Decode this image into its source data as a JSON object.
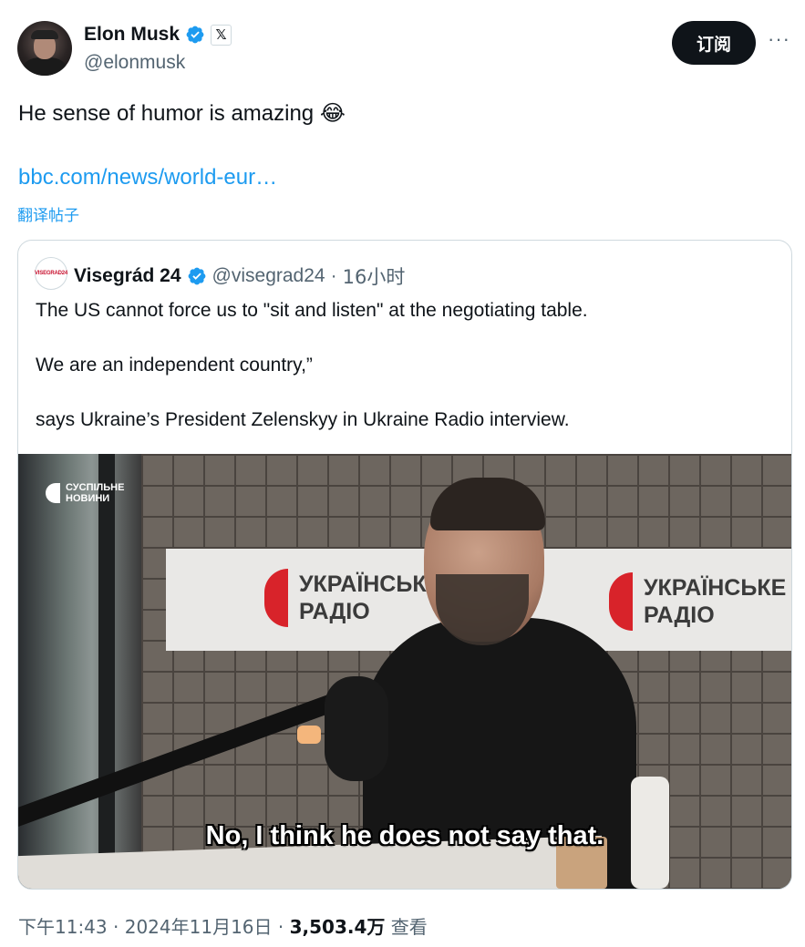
{
  "author": {
    "name": "Elon Musk",
    "handle": "@elonmusk",
    "x_badge": "𝕏"
  },
  "actions": {
    "subscribe_label": "订阅",
    "more_label": "···"
  },
  "tweet": {
    "text": "He sense of humor is amazing 😂",
    "link": "bbc.com/news/world-eur…",
    "translate_label": "翻译帖子"
  },
  "quote": {
    "avatar_text": "VISEGRAD24",
    "name": "Visegrád 24",
    "handle": "@visegrad24",
    "separator": "·",
    "time": "16小时",
    "paragraphs": [
      "The US cannot force us to \"sit and listen\" at the negotiating table.",
      "We are an independent country,”",
      "says Ukraine’s President Zelenskyy in Ukraine Radio interview."
    ],
    "video": {
      "logo_line1": "СУСПІЛЬНЕ",
      "logo_line2": "НОВИНИ",
      "sign_line1": "УКРАЇНСЬКЕ",
      "sign_line2": "РАДІО",
      "caption": "No, I think he does not say that."
    }
  },
  "footer": {
    "time": "下午11:43",
    "sep1": "·",
    "date": "2024年11月16日",
    "sep2": "·",
    "views": "3,503.4万",
    "views_label": "查看"
  },
  "colors": {
    "accent": "#1d9bf0",
    "text": "#0f1419",
    "secondary": "#536471",
    "border": "#cfd9de"
  }
}
